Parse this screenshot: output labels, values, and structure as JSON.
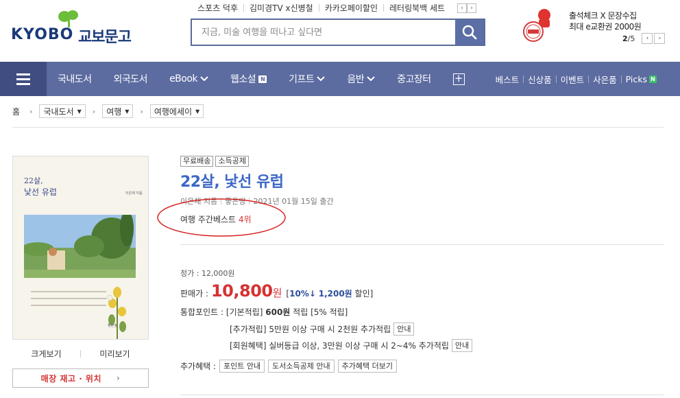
{
  "logo": {
    "text": "KYOBO",
    "korean": "교보문고"
  },
  "quick_links": [
    "스포츠 덕후",
    "김미경TV x신병철",
    "카카오페이할인",
    "레터링북백 세트"
  ],
  "search": {
    "placeholder": "지금, 미술 여행을 떠나고 싶다면"
  },
  "promo": {
    "line1": "출석체크 X 문장수집",
    "line2": "최대 e교환권 2000원",
    "page_current": "2",
    "page_total": "/5"
  },
  "nav": {
    "items": [
      "국내도서",
      "외국도서",
      "eBook",
      "웹소설",
      "기프트",
      "음반",
      "중고장터"
    ],
    "new_badge": "N",
    "right_items": [
      "베스트",
      "신상품",
      "이벤트",
      "사은품",
      "Picks"
    ],
    "picks_badge": "N"
  },
  "breadcrumb": {
    "home": "홈",
    "levels": [
      "국내도서",
      "여행",
      "여행에세이"
    ]
  },
  "book": {
    "cover_title_line1": "22살,",
    "cover_title_line2": "낯선 유럽",
    "cover_author": "이은채 지음",
    "cover_publisher": "좋은땅",
    "tags": [
      "무료배송",
      "소득공제"
    ],
    "title": "22살, 낯선 유럽",
    "author": "이은채 지음",
    "publisher": "좋은땅",
    "date": "2021년 01월 15일 출간",
    "best_label": "여행 주간베스트",
    "best_rank": "4위"
  },
  "cover_links": {
    "zoom": "크게보기",
    "preview": "미리보기",
    "stock": "매장 재고 · 위치"
  },
  "price": {
    "list_label": "정가 : 12,000원",
    "sale_label": "판매가 :",
    "sale_value": "10,800",
    "sale_unit": "원",
    "discount_open": "[",
    "discount_pct": "10%↓",
    "discount_amount": "1,200원",
    "discount_close": "할인]",
    "point_label": "통합포인트 :",
    "point_basic": "[기본적립]",
    "point_value": "600원",
    "point_rest": "적립 [5% 적립]",
    "extra1": "[추가적립] 5만원 이상 구매 시 2천원 추가적립",
    "extra2": "[회원혜택] 실버등급 이상, 3만원 이상 구매 시 2~4% 추가적립",
    "guide": "안내",
    "benefit_label": "추가혜택 :",
    "benefit_buttons": [
      "포인트 안내",
      "도서소득공제 안내",
      "추가혜택 더보기"
    ]
  }
}
